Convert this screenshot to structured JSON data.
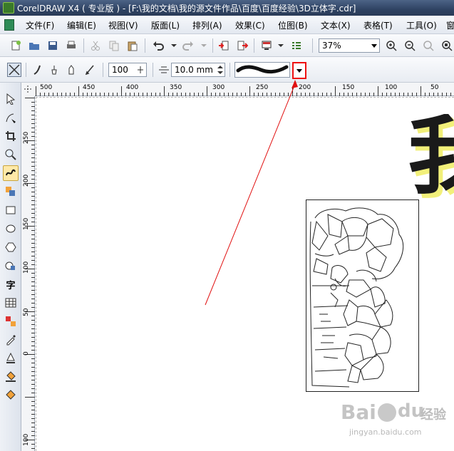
{
  "window": {
    "title": "CorelDRAW X4 ( 专业版 ) - [F:\\我的文档\\我的源文件作品\\百度\\百度经验\\3D立体字.cdr]"
  },
  "menu": [
    {
      "label": "文件(F)"
    },
    {
      "label": "编辑(E)"
    },
    {
      "label": "视图(V)"
    },
    {
      "label": "版面(L)"
    },
    {
      "label": "排列(A)"
    },
    {
      "label": "效果(C)"
    },
    {
      "label": "位图(B)"
    },
    {
      "label": "文本(X)"
    },
    {
      "label": "表格(T)"
    },
    {
      "label": "工具(O)"
    },
    {
      "label": "窗"
    }
  ],
  "toolbar": {
    "zoom_value": "37%"
  },
  "property_bar": {
    "smoothness_value": "100",
    "width_value": "10.0 mm"
  },
  "ruler_h": [
    "500",
    "450",
    "400",
    "350",
    "300",
    "250",
    "200",
    "150",
    "100",
    "50"
  ],
  "ruler_v": [
    "250",
    "200",
    "150",
    "100",
    "50",
    "0",
    "100"
  ],
  "toolbox_tools": [
    {
      "name": "pick-tool-icon",
      "glyph": "↖"
    },
    {
      "name": "shape-tool-icon",
      "glyph": "◣"
    },
    {
      "name": "crop-tool-icon",
      "glyph": "⌗"
    },
    {
      "name": "zoom-tool-icon",
      "glyph": "🔍"
    },
    {
      "name": "freehand-tool-icon",
      "glyph": "∿"
    },
    {
      "name": "smart-fill-tool-icon",
      "glyph": "▚"
    },
    {
      "name": "rectangle-tool-icon",
      "glyph": "□"
    },
    {
      "name": "ellipse-tool-icon",
      "glyph": "○"
    },
    {
      "name": "polygon-tool-icon",
      "glyph": "⬡"
    },
    {
      "name": "basic-shapes-tool-icon",
      "glyph": "◔"
    },
    {
      "name": "text-tool-icon",
      "glyph": "字"
    },
    {
      "name": "table-tool-icon",
      "glyph": "▦"
    },
    {
      "name": "interactive-blend-tool-icon",
      "glyph": "◪"
    },
    {
      "name": "eyedropper-tool-icon",
      "glyph": "✎"
    },
    {
      "name": "outline-tool-icon",
      "glyph": "◬"
    },
    {
      "name": "fill-tool-icon",
      "glyph": "◭"
    },
    {
      "name": "interactive-fill-tool-icon",
      "glyph": "◈"
    }
  ],
  "canvas": {
    "big_glyph": "我"
  },
  "watermark": {
    "brand": "Bai",
    "brand2": "du",
    "suffix": "经验",
    "url": "jingyan.baidu.com"
  },
  "colors": {
    "annotation_red": "#e11111",
    "glyph_shadow": "#f2f07a"
  }
}
